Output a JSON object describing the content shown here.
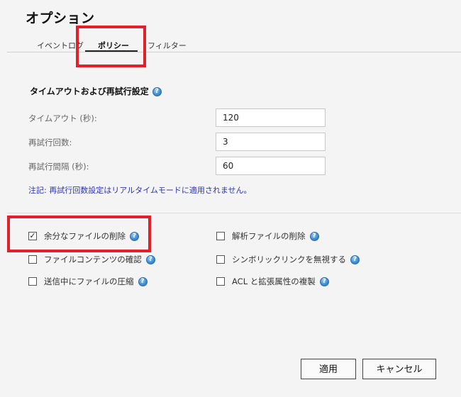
{
  "dialog": {
    "title": "オプション"
  },
  "tabs": [
    {
      "label": "イベントログ",
      "active": false
    },
    {
      "label": "ポリシー",
      "active": true
    },
    {
      "label": "フィルター",
      "active": false
    }
  ],
  "timeout_section": {
    "title": "タイムアウトおよび再試行設定",
    "help_icon": "help-icon",
    "fields": [
      {
        "label": "タイムアウト (秒):",
        "value": "120"
      },
      {
        "label": "再試行回数:",
        "value": "3"
      },
      {
        "label": "再試行間隔 (秒):",
        "value": "60"
      }
    ],
    "note": "注記: 再試行回数設定はリアルタイムモードに適用されません。"
  },
  "options": {
    "left": [
      {
        "label": "余分なファイルの削除",
        "checked": true
      },
      {
        "label": "ファイルコンテンツの確認",
        "checked": false
      },
      {
        "label": "送信中にファイルの圧縮",
        "checked": false
      }
    ],
    "right": [
      {
        "label": "解析ファイルの削除",
        "checked": false
      },
      {
        "label": "シンボリックリンクを無視する",
        "checked": false
      },
      {
        "label": "ACL と拡張属性の複製",
        "checked": false
      }
    ]
  },
  "buttons": {
    "apply": "適用",
    "cancel": "キャンセル"
  },
  "colors": {
    "highlight": "#e0202a",
    "note": "#2b33b8",
    "help_icon": "#3f8fd6"
  }
}
